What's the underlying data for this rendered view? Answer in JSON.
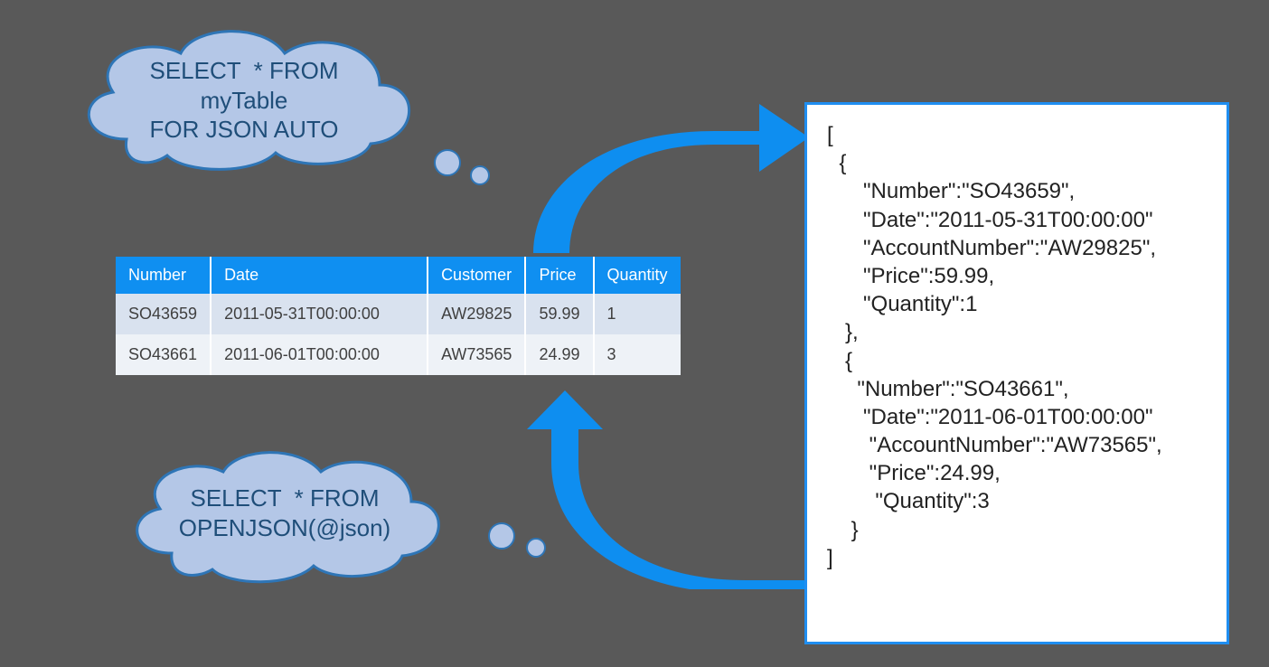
{
  "clouds": {
    "top": {
      "line1": "SELECT  * FROM",
      "line2": "myTable",
      "line3": "FOR JSON AUTO"
    },
    "bottom": {
      "line1": "SELECT  * FROM",
      "line2": "OPENJSON(@json)"
    }
  },
  "table": {
    "headers": [
      "Number",
      "Date",
      "Customer",
      "Price",
      "Quantity"
    ],
    "rows": [
      [
        "SO43659",
        "2011-05-31T00:00:00",
        "AW29825",
        "59.99",
        "1"
      ],
      [
        "SO43661",
        "2011-06-01T00:00:00",
        "AW73565",
        "24.99",
        "3"
      ]
    ]
  },
  "json_output": "[\n  {\n      \"Number\":\"SO43659\",\n      \"Date\":\"2011-05-31T00:00:00\"\n      \"AccountNumber\":\"AW29825\",\n      \"Price\":59.99,\n      \"Quantity\":1\n   },\n   {\n     \"Number\":\"SO43661\",\n      \"Date\":\"2011-06-01T00:00:00\"\n       \"AccountNumber\":\"AW73565\",\n       \"Price\":24.99,\n        \"Quantity\":3\n    }\n]",
  "colors": {
    "cloud_fill": "#b4c7e7",
    "cloud_stroke": "#2e75b6",
    "arrow": "#0e8ef0",
    "table_header": "#0f8ff1",
    "panel_border": "#1f8ef1"
  }
}
